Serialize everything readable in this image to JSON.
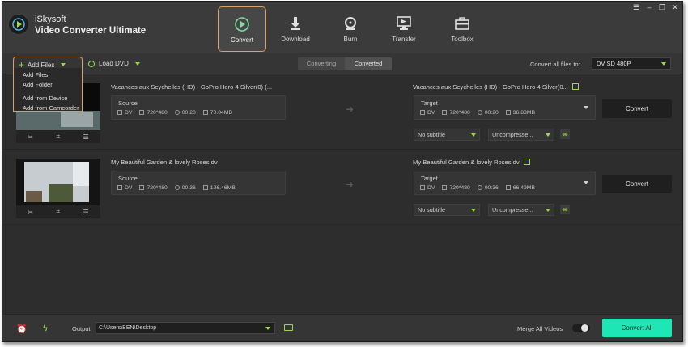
{
  "app": {
    "brand_line1": "iSkysoft",
    "brand_line2": "Video Converter Ultimate"
  },
  "nav": [
    {
      "label": "Convert",
      "icon": "convert-icon",
      "active": true
    },
    {
      "label": "Download",
      "icon": "download-icon",
      "active": false
    },
    {
      "label": "Burn",
      "icon": "burn-icon",
      "active": false
    },
    {
      "label": "Transfer",
      "icon": "transfer-icon",
      "active": false
    },
    {
      "label": "Toolbox",
      "icon": "toolbox-icon",
      "active": false
    }
  ],
  "window_controls": {
    "menu": "☰",
    "minimize": "–",
    "restore": "❐",
    "close": "✕"
  },
  "toolbar": {
    "add_files_label": "Add Files",
    "load_dvd_label": "Load DVD",
    "tab_converting": "Converting",
    "tab_converted": "Converted",
    "convert_all_label": "Convert all files to:",
    "format_value": "DV SD 480P"
  },
  "add_files_menu": [
    "Add Files",
    "Add Folder",
    "Add from Device",
    "Add from Camcorder"
  ],
  "items": [
    {
      "title": "Vacances aux Seychelles (HD) - GoPro Hero 4 Silver(0) (...",
      "target_title": "Vacances aux Seychelles (HD) - GoPro Hero 4 Silver(0...",
      "source_label": "Source",
      "target_label": "Target",
      "source": {
        "format": "DV",
        "resolution": "720*480",
        "duration": "00:20",
        "size": "70.04MB"
      },
      "target": {
        "format": "DV",
        "resolution": "720*480",
        "duration": "00:20",
        "size": "36.83MB"
      },
      "subtitle": "No subtitle",
      "audio": "Uncompresse...",
      "convert_label": "Convert"
    },
    {
      "title": "My Beautiful Garden & lovely Roses.dv",
      "target_title": "My Beautiful Garden & lovely Roses.dv",
      "source_label": "Source",
      "target_label": "Target",
      "source": {
        "format": "DV",
        "resolution": "720*480",
        "duration": "00:36",
        "size": "126.46MB"
      },
      "target": {
        "format": "DV",
        "resolution": "720*480",
        "duration": "00:36",
        "size": "66.49MB"
      },
      "subtitle": "No subtitle",
      "audio": "Uncompresse...",
      "convert_label": "Convert"
    }
  ],
  "footer": {
    "output_label": "Output",
    "output_path": "C:\\Users\\BEN\\Desktop",
    "merge_label": "Merge All Videos",
    "merge_on": false,
    "convert_all_button": "Convert All"
  },
  "colors": {
    "accent_green": "#9cd94a",
    "active_outline": "#e0a060",
    "convert_all_bg": "#1ee6b4"
  }
}
